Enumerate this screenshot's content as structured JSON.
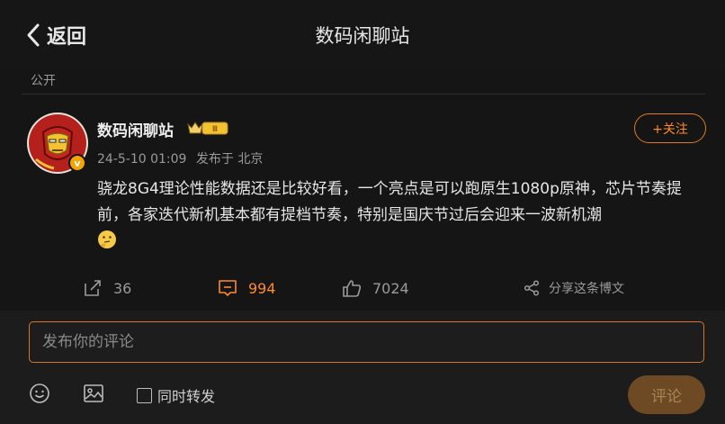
{
  "header": {
    "back_label": "返回",
    "title": "数码闲聊站"
  },
  "post": {
    "visibility": "公开",
    "author": "数码闲聊站",
    "level_badge": "Ⅲ",
    "verified_badge": "v",
    "date": "24-5-10 01:09",
    "location": "发布于 北京",
    "follow_label": "+关注",
    "text": "骁龙8G4理论性能数据还是比较好看，一个亮点是可以跑原生1080p原神，芯片节奏提前，各家迭代新机基本都有提档节奏，特别是国庆节过后会迎来一波新机潮",
    "emoji": "thinking-face-emoji"
  },
  "actions": {
    "reposts": "36",
    "comments": "994",
    "likes": "7024",
    "share_label": "分享这条博文"
  },
  "composer": {
    "placeholder": "发布你的评论",
    "forward_label": "同时转发",
    "submit_label": "评论"
  },
  "colors": {
    "accent": "#ff8a2a",
    "background": "#151515",
    "submit_bg": "#6d4a23"
  }
}
